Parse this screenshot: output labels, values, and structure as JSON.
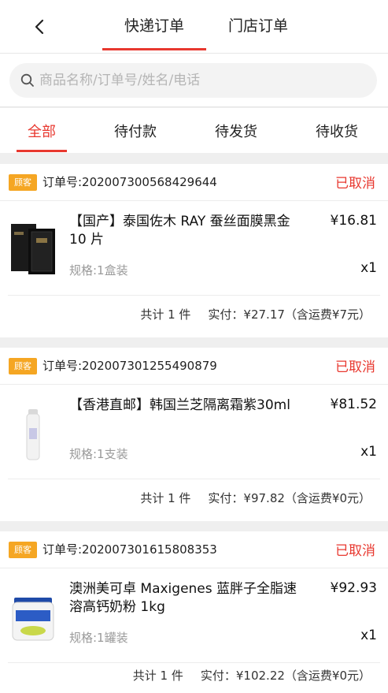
{
  "header": {
    "back_icon": "chevron-left-icon",
    "tabs": [
      {
        "label": "快递订单",
        "active": true
      },
      {
        "label": "门店订单",
        "active": false
      }
    ]
  },
  "search": {
    "placeholder": "商品名称/订单号/姓名/电话",
    "icon": "search-icon"
  },
  "filter_tabs": [
    {
      "label": "全部",
      "active": true
    },
    {
      "label": "待付款",
      "active": false
    },
    {
      "label": "待发货",
      "active": false
    },
    {
      "label": "待收货",
      "active": false
    }
  ],
  "colors": {
    "accent": "#e8382f",
    "badge": "#f5a623"
  },
  "orders": [
    {
      "badge": "顾客",
      "order_no": "订单号:202007300568429644",
      "status": "已取消",
      "product_name": "【国产】泰国佐木 RAY 蚕丝面膜黑金 10 片",
      "price": "¥16.81",
      "spec": "规格:1盒装",
      "qty": "x1",
      "total_count": "共计 1 件",
      "paid": "实付：¥27.17（含运费¥7元）"
    },
    {
      "badge": "顾客",
      "order_no": "订单号:202007301255490879",
      "status": "已取消",
      "product_name": "【香港直邮】韩国兰芝隔离霜紫30ml",
      "price": "¥81.52",
      "spec": "规格:1支装",
      "qty": "x1",
      "total_count": "共计 1 件",
      "paid": "实付：¥97.82（含运费¥0元）"
    },
    {
      "badge": "顾客",
      "order_no": "订单号:202007301615808353",
      "status": "已取消",
      "product_name": "澳洲美可卓 Maxigenes 蓝胖子全脂速溶高钙奶粉 1kg",
      "price": "¥92.93",
      "spec": "规格:1罐装",
      "qty": "x1",
      "total_count": "共计 1 件",
      "paid": "实付：¥102.22（含运费¥0元）"
    }
  ]
}
